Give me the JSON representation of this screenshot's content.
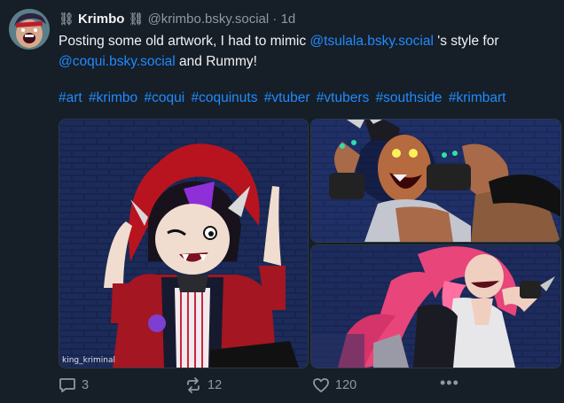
{
  "post": {
    "author": {
      "display_name": "Krimbo",
      "decoration_left": "⛓",
      "decoration_right": "⛓",
      "handle": "@krimbo.bsky.social",
      "separator": "·",
      "time": "1d"
    },
    "text": {
      "part1": "Posting some old artwork, I had to mimic ",
      "mention1": "@tsulala.bsky.social",
      "part2": "  's style for ",
      "mention2": "@coqui.bsky.social",
      "part3": "  and Rummy!"
    },
    "hashtags": [
      "#art",
      "#krimbo",
      "#coqui",
      "#coquinuts",
      "#vtuber",
      "#vtubers",
      "#southside",
      "#krimbart"
    ],
    "images": {
      "watermark": "king_kriminal"
    },
    "actions": {
      "reply_count": "3",
      "repost_count": "12",
      "like_count": "120",
      "more_label": "•••"
    }
  },
  "colors": {
    "background": "#161e27",
    "link": "#208bfe",
    "muted": "#8d99a6"
  }
}
